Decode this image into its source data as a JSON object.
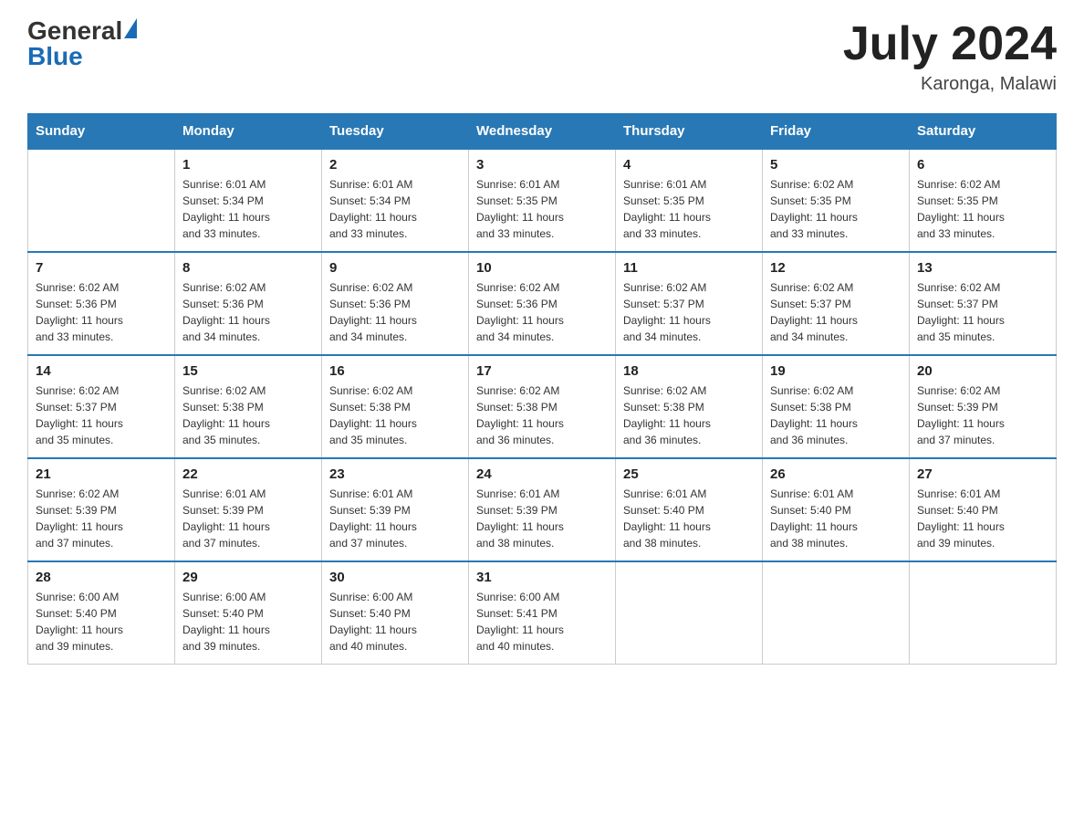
{
  "header": {
    "logo_general": "General",
    "logo_blue": "Blue",
    "title": "July 2024",
    "location": "Karonga, Malawi"
  },
  "days_of_week": [
    "Sunday",
    "Monday",
    "Tuesday",
    "Wednesday",
    "Thursday",
    "Friday",
    "Saturday"
  ],
  "weeks": [
    [
      {
        "day": "",
        "info": ""
      },
      {
        "day": "1",
        "info": "Sunrise: 6:01 AM\nSunset: 5:34 PM\nDaylight: 11 hours\nand 33 minutes."
      },
      {
        "day": "2",
        "info": "Sunrise: 6:01 AM\nSunset: 5:34 PM\nDaylight: 11 hours\nand 33 minutes."
      },
      {
        "day": "3",
        "info": "Sunrise: 6:01 AM\nSunset: 5:35 PM\nDaylight: 11 hours\nand 33 minutes."
      },
      {
        "day": "4",
        "info": "Sunrise: 6:01 AM\nSunset: 5:35 PM\nDaylight: 11 hours\nand 33 minutes."
      },
      {
        "day": "5",
        "info": "Sunrise: 6:02 AM\nSunset: 5:35 PM\nDaylight: 11 hours\nand 33 minutes."
      },
      {
        "day": "6",
        "info": "Sunrise: 6:02 AM\nSunset: 5:35 PM\nDaylight: 11 hours\nand 33 minutes."
      }
    ],
    [
      {
        "day": "7",
        "info": "Sunrise: 6:02 AM\nSunset: 5:36 PM\nDaylight: 11 hours\nand 33 minutes."
      },
      {
        "day": "8",
        "info": "Sunrise: 6:02 AM\nSunset: 5:36 PM\nDaylight: 11 hours\nand 34 minutes."
      },
      {
        "day": "9",
        "info": "Sunrise: 6:02 AM\nSunset: 5:36 PM\nDaylight: 11 hours\nand 34 minutes."
      },
      {
        "day": "10",
        "info": "Sunrise: 6:02 AM\nSunset: 5:36 PM\nDaylight: 11 hours\nand 34 minutes."
      },
      {
        "day": "11",
        "info": "Sunrise: 6:02 AM\nSunset: 5:37 PM\nDaylight: 11 hours\nand 34 minutes."
      },
      {
        "day": "12",
        "info": "Sunrise: 6:02 AM\nSunset: 5:37 PM\nDaylight: 11 hours\nand 34 minutes."
      },
      {
        "day": "13",
        "info": "Sunrise: 6:02 AM\nSunset: 5:37 PM\nDaylight: 11 hours\nand 35 minutes."
      }
    ],
    [
      {
        "day": "14",
        "info": "Sunrise: 6:02 AM\nSunset: 5:37 PM\nDaylight: 11 hours\nand 35 minutes."
      },
      {
        "day": "15",
        "info": "Sunrise: 6:02 AM\nSunset: 5:38 PM\nDaylight: 11 hours\nand 35 minutes."
      },
      {
        "day": "16",
        "info": "Sunrise: 6:02 AM\nSunset: 5:38 PM\nDaylight: 11 hours\nand 35 minutes."
      },
      {
        "day": "17",
        "info": "Sunrise: 6:02 AM\nSunset: 5:38 PM\nDaylight: 11 hours\nand 36 minutes."
      },
      {
        "day": "18",
        "info": "Sunrise: 6:02 AM\nSunset: 5:38 PM\nDaylight: 11 hours\nand 36 minutes."
      },
      {
        "day": "19",
        "info": "Sunrise: 6:02 AM\nSunset: 5:38 PM\nDaylight: 11 hours\nand 36 minutes."
      },
      {
        "day": "20",
        "info": "Sunrise: 6:02 AM\nSunset: 5:39 PM\nDaylight: 11 hours\nand 37 minutes."
      }
    ],
    [
      {
        "day": "21",
        "info": "Sunrise: 6:02 AM\nSunset: 5:39 PM\nDaylight: 11 hours\nand 37 minutes."
      },
      {
        "day": "22",
        "info": "Sunrise: 6:01 AM\nSunset: 5:39 PM\nDaylight: 11 hours\nand 37 minutes."
      },
      {
        "day": "23",
        "info": "Sunrise: 6:01 AM\nSunset: 5:39 PM\nDaylight: 11 hours\nand 37 minutes."
      },
      {
        "day": "24",
        "info": "Sunrise: 6:01 AM\nSunset: 5:39 PM\nDaylight: 11 hours\nand 38 minutes."
      },
      {
        "day": "25",
        "info": "Sunrise: 6:01 AM\nSunset: 5:40 PM\nDaylight: 11 hours\nand 38 minutes."
      },
      {
        "day": "26",
        "info": "Sunrise: 6:01 AM\nSunset: 5:40 PM\nDaylight: 11 hours\nand 38 minutes."
      },
      {
        "day": "27",
        "info": "Sunrise: 6:01 AM\nSunset: 5:40 PM\nDaylight: 11 hours\nand 39 minutes."
      }
    ],
    [
      {
        "day": "28",
        "info": "Sunrise: 6:00 AM\nSunset: 5:40 PM\nDaylight: 11 hours\nand 39 minutes."
      },
      {
        "day": "29",
        "info": "Sunrise: 6:00 AM\nSunset: 5:40 PM\nDaylight: 11 hours\nand 39 minutes."
      },
      {
        "day": "30",
        "info": "Sunrise: 6:00 AM\nSunset: 5:40 PM\nDaylight: 11 hours\nand 40 minutes."
      },
      {
        "day": "31",
        "info": "Sunrise: 6:00 AM\nSunset: 5:41 PM\nDaylight: 11 hours\nand 40 minutes."
      },
      {
        "day": "",
        "info": ""
      },
      {
        "day": "",
        "info": ""
      },
      {
        "day": "",
        "info": ""
      }
    ]
  ]
}
